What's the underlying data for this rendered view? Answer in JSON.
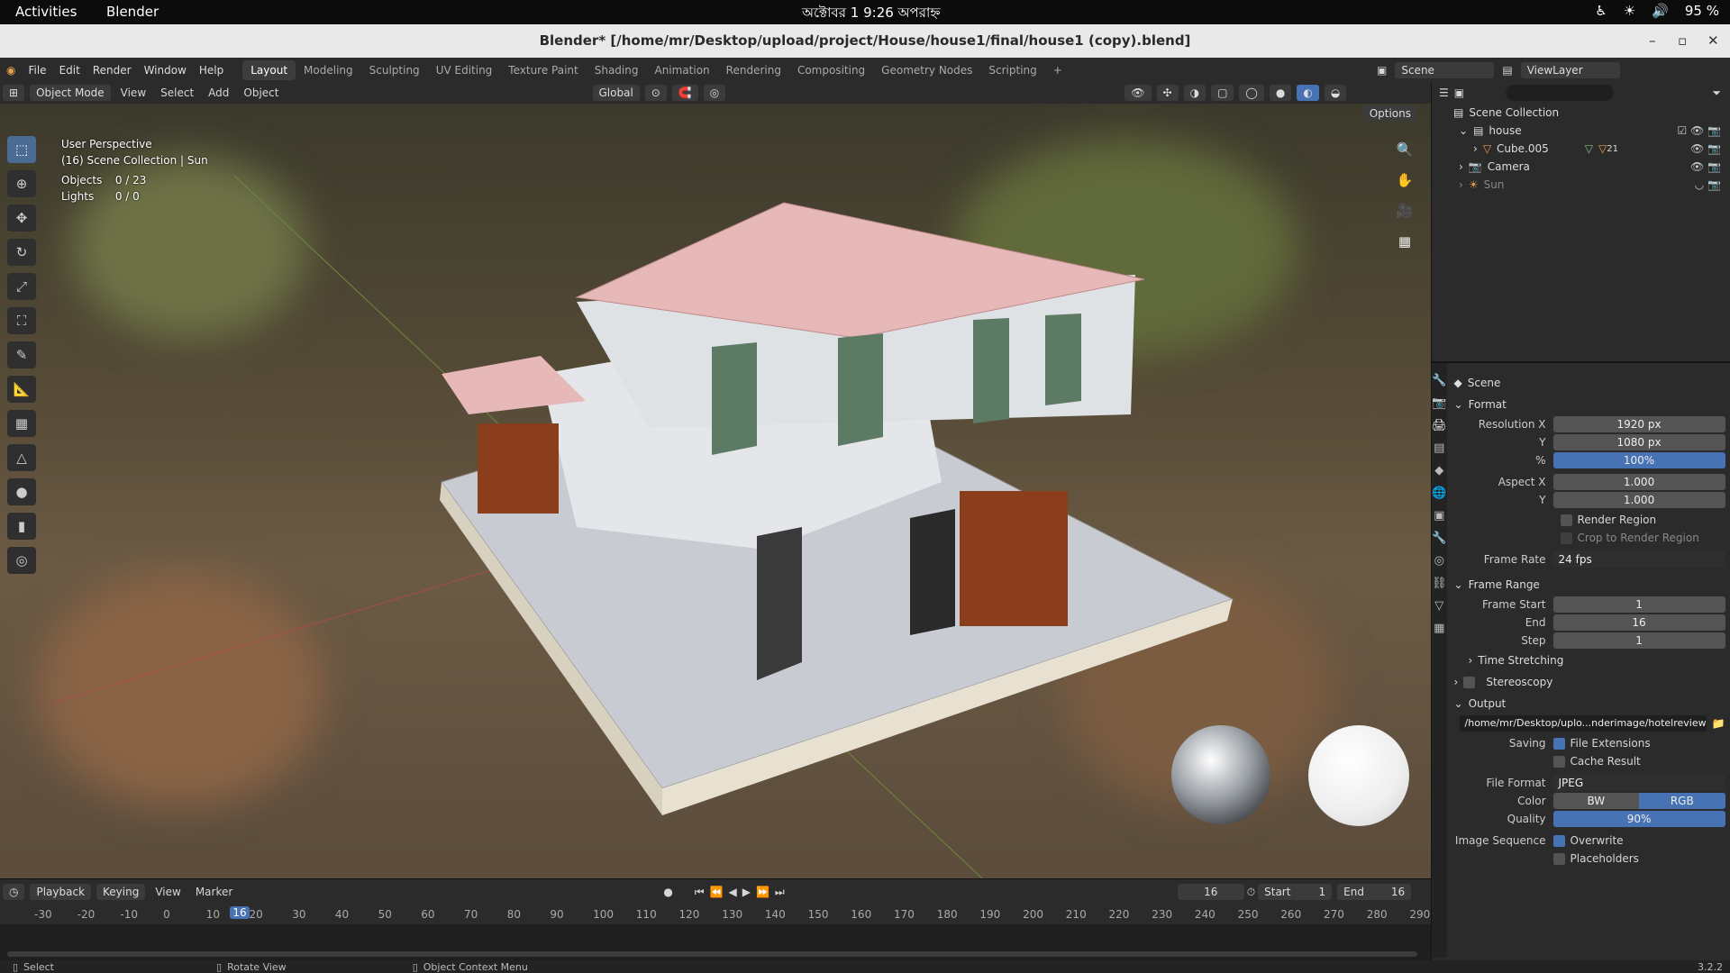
{
  "gnome": {
    "activities": "Activities",
    "app": "Blender",
    "clock": "অক্টোবর 1  9:26 অপরাহ্ন",
    "battery": "95 %"
  },
  "window": {
    "title": "Blender* [/home/mr/Desktop/upload/project/House/house1/final/house1 (copy).blend]"
  },
  "menu": [
    "File",
    "Edit",
    "Render",
    "Window",
    "Help"
  ],
  "workspaces": [
    "Layout",
    "Modeling",
    "Sculpting",
    "UV Editing",
    "Texture Paint",
    "Shading",
    "Animation",
    "Rendering",
    "Compositing",
    "Geometry Nodes",
    "Scripting",
    "+"
  ],
  "scene_selector": "Scene",
  "viewlayer_selector": "ViewLayer",
  "viewport_header": {
    "mode": "Object Mode",
    "items": [
      "View",
      "Select",
      "Add",
      "Object"
    ],
    "orientation": "Global",
    "options": "Options"
  },
  "viewport_info": {
    "line1": "User Perspective",
    "line2": "(16) Scene Collection | Sun",
    "objects_label": "Objects",
    "objects_value": "0 / 23",
    "lights_label": "Lights",
    "lights_value": "0 / 0"
  },
  "outliner": {
    "root": "Scene Collection",
    "items": [
      {
        "label": "house"
      },
      {
        "label": "Cube.005",
        "extra": "21"
      },
      {
        "label": "Camera"
      },
      {
        "label": "Sun"
      }
    ]
  },
  "properties": {
    "context": "Scene",
    "format_title": "Format",
    "res_x_label": "Resolution X",
    "res_x": "1920 px",
    "res_y_label": "Y",
    "res_y": "1080 px",
    "pct_label": "%",
    "pct": "100%",
    "aspect_x_label": "Aspect X",
    "aspect_x": "1.000",
    "aspect_y_label": "Y",
    "aspect_y": "1.000",
    "render_region": "Render Region",
    "crop_region": "Crop to Render Region",
    "frame_rate_label": "Frame Rate",
    "frame_rate": "24 fps",
    "frame_range_title": "Frame Range",
    "frame_start_label": "Frame Start",
    "frame_start": "1",
    "end_label": "End",
    "end": "16",
    "step_label": "Step",
    "step": "1",
    "time_stretching": "Time Stretching",
    "stereoscopy": "Stereoscopy",
    "output_title": "Output",
    "output_path": "/home/mr/Desktop/uplo...nderimage/hotelreview",
    "saving_label": "Saving",
    "file_extensions": "File Extensions",
    "cache_result": "Cache Result",
    "file_format_label": "File Format",
    "file_format": "JPEG",
    "color_label": "Color",
    "color_bw": "BW",
    "color_rgb": "RGB",
    "quality_label": "Quality",
    "quality": "90%",
    "image_sequence_label": "Image Sequence",
    "overwrite": "Overwrite",
    "placeholders": "Placeholders"
  },
  "timeline": {
    "playback": "Playback",
    "keying": "Keying",
    "view": "View",
    "marker": "Marker",
    "current_frame": "16",
    "start_label": "Start",
    "start": "1",
    "end_label": "End",
    "end": "16",
    "ruler": [
      "-30",
      "-20",
      "-10",
      "0",
      "10",
      "20",
      "30",
      "40",
      "50",
      "60",
      "70",
      "80",
      "90",
      "100",
      "110",
      "120",
      "130",
      "140",
      "150",
      "160",
      "170",
      "180",
      "190",
      "200",
      "210",
      "220",
      "230",
      "240",
      "250",
      "260",
      "270",
      "280",
      "290"
    ]
  },
  "statusbar": {
    "select": "Select",
    "rotate": "Rotate View",
    "context": "Object Context Menu",
    "version": "3.2.2"
  }
}
